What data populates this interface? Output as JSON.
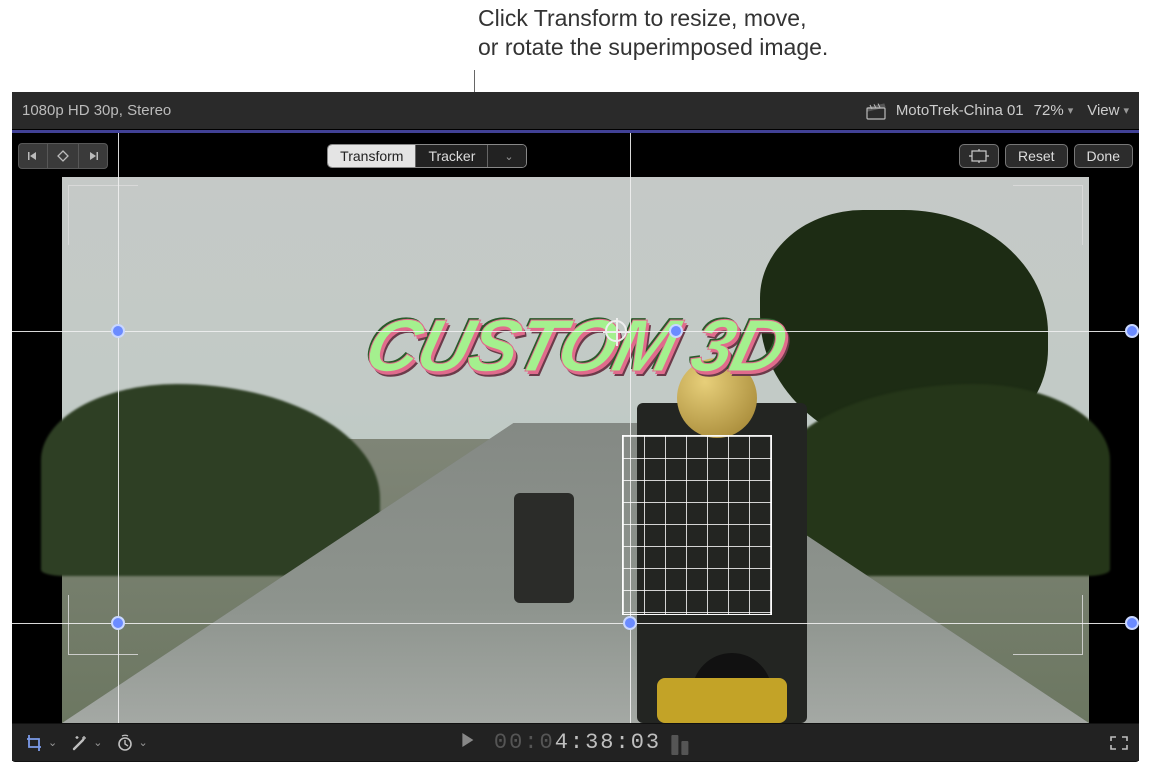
{
  "annotation": {
    "line1": "Click Transform to resize, move,",
    "line2": "or rotate the superimposed image."
  },
  "info_bar": {
    "format": "1080p HD 30p, Stereo",
    "clip_name": "MotoTrek-China 01",
    "zoom": "72%",
    "view_label": "View"
  },
  "overlay": {
    "transform_label": "Transform",
    "tracker_label": "Tracker",
    "reset_label": "Reset",
    "done_label": "Done"
  },
  "title_text": "CUSTOM 3D",
  "timecode": {
    "dim_part": "00:0",
    "lit_part": "4:38:03"
  },
  "icons": {
    "clapper": "clapper-icon",
    "crop": "crop-icon",
    "wand": "wand-icon",
    "retime": "retime-icon",
    "fullscreen": "fullscreen-icon",
    "keyframe_back": "keyframe-prev",
    "keyframe_add": "keyframe-add",
    "keyframe_fwd": "keyframe-next",
    "grid": "grid-toggle"
  }
}
